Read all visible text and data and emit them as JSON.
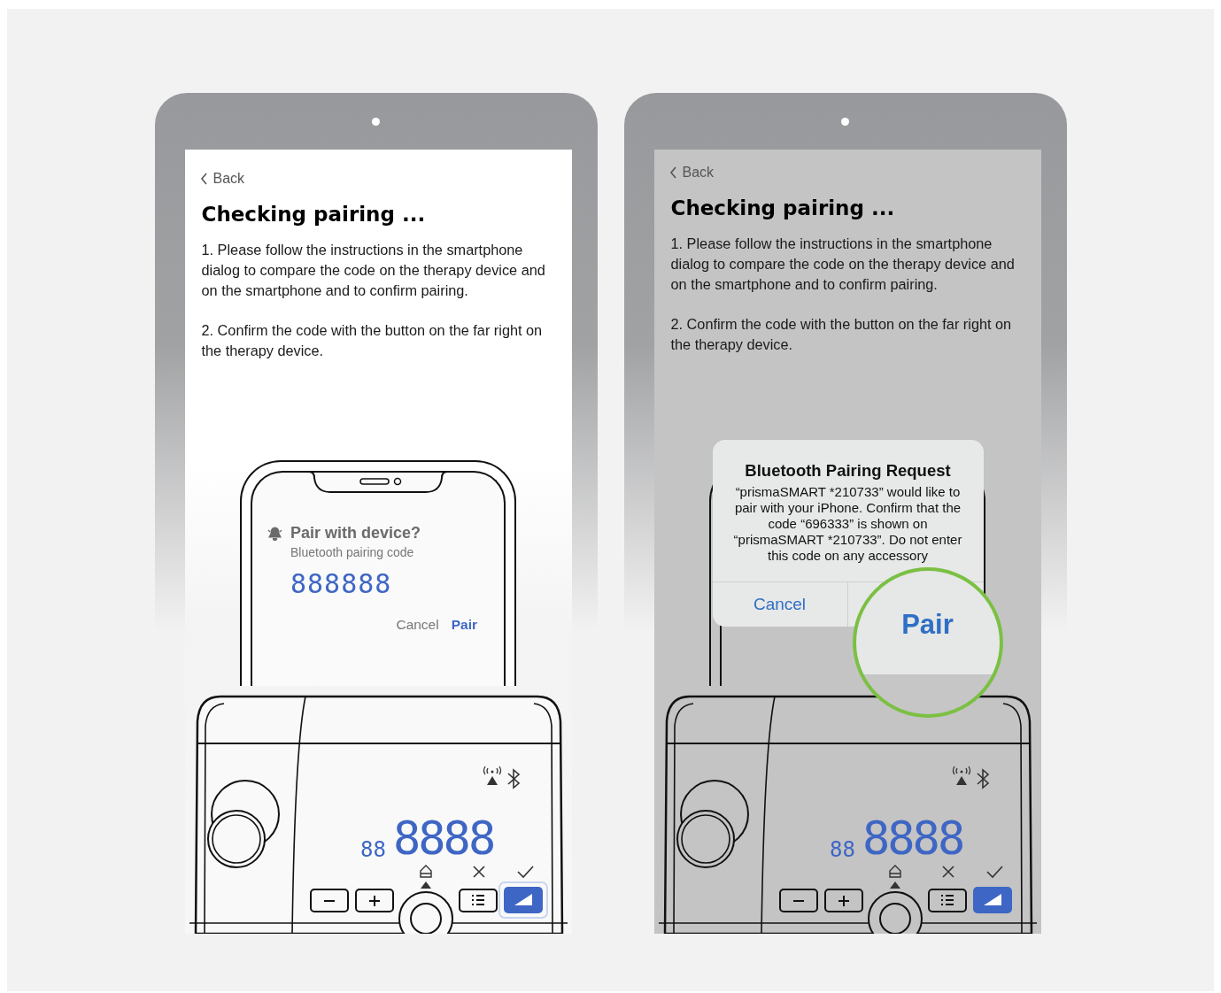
{
  "tablets": [
    {
      "dimmed": false,
      "back": "Back",
      "title": "Checking pairing ...",
      "steps": [
        "1. Please follow the instructions in the smartphone dialog to compare the code on the therapy device and on the smartphone and to confirm pairing.",
        "2. Confirm the code with the button on the far right on the therapy device."
      ],
      "phone_dialog": {
        "kind": "android",
        "title": "Pair with device?",
        "subtitle": "Bluetooth pairing code",
        "code": "888888",
        "buttons": [
          "Cancel",
          "Pair"
        ]
      },
      "device": {
        "small_digits": "88",
        "digits": "8888",
        "confirm_highlighted": true
      }
    },
    {
      "dimmed": true,
      "back": "Back",
      "title": "Checking pairing ...",
      "steps": [
        "1. Please follow the instructions in the smartphone dialog to compare the code on the therapy device and on the smartphone and to confirm pairing.",
        "2. Confirm the code with the button on the far right on the therapy device."
      ],
      "phone_dialog": {
        "kind": "ios",
        "title": "Bluetooth Pairing Request",
        "message": "“prismaSMART *210733” would like to pair with your iPhone. Confirm that the code “696333” is shown on “prismaSMART *210733”. Do not enter this code on any accessory",
        "buttons": [
          "Cancel"
        ],
        "magnified_button": "Pair"
      },
      "device": {
        "small_digits": "88",
        "digits": "8888",
        "confirm_highlighted": false
      }
    }
  ]
}
